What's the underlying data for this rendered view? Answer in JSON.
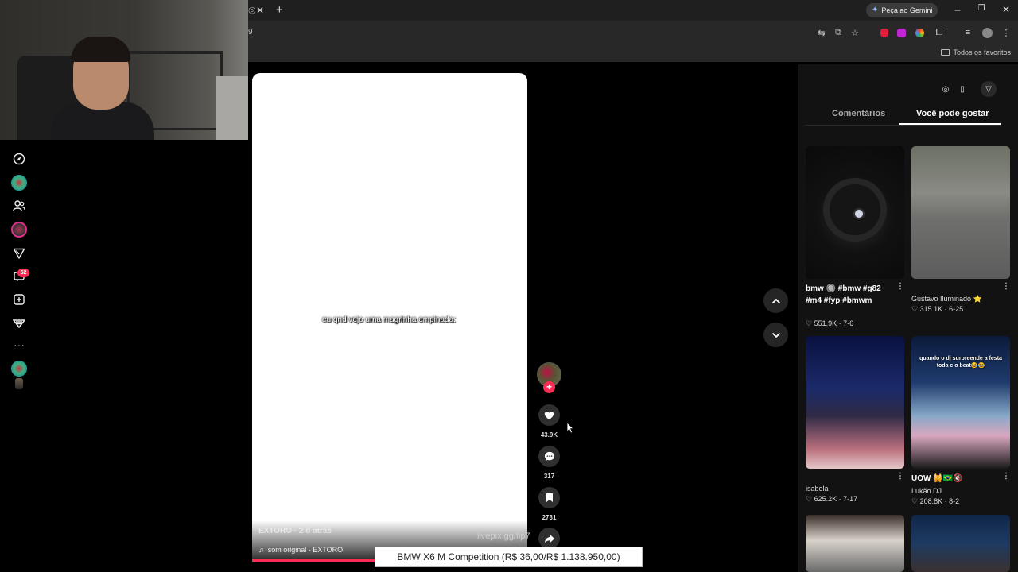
{
  "browser": {
    "gemini_button": "Peça ao Gemini",
    "bookmarks_folder": "Todos os favoritos",
    "url_fragment": "9"
  },
  "sidebar": {
    "notification_count": "62"
  },
  "video": {
    "caption": "eu qnd vejo uma magrinha empinada:",
    "author": "EXTORO · 2 d atrás",
    "sound": "som original - EXTORO",
    "likes": "43.9K",
    "comments": "317",
    "saves": "2731"
  },
  "overlay": {
    "livepix": "livepix.gg/flp7",
    "donation": "BMW X6 M Competition (R$ 36,00/R$ 1.138.950,00)"
  },
  "right_panel": {
    "tabs": [
      "Comentários",
      "Você pode gostar"
    ],
    "cards": [
      {
        "title": "bmw 🔘 #bmw #g82 #m4 #fyp #bmwm",
        "user": "",
        "likes": "551.9K",
        "date": "7-6"
      },
      {
        "title": "",
        "user": "Gustavo Iluminado ⭐",
        "likes": "315.1K",
        "date": "6-25"
      },
      {
        "title": "",
        "user": "isabela",
        "likes": "625.2K",
        "date": "7-17"
      },
      {
        "title": "UOW 🙀🇧🇷🔇",
        "user": "Lukão DJ",
        "likes": "208.8K",
        "date": "8-2"
      }
    ],
    "thumb4_text": "quando o dj surpreende a festa toda c o beat😂😂"
  },
  "icons": [
    "close-icon",
    "plus-icon",
    "minimize-icon",
    "restore-icon",
    "translate-icon",
    "cast-icon",
    "star-icon",
    "extension-icon",
    "profile-icon",
    "more-icon",
    "compass-icon",
    "users-icon",
    "send-icon",
    "inbox-icon",
    "upload-icon",
    "heart-icon",
    "comment-icon",
    "bookmark-icon",
    "share-icon",
    "chevron-up-icon",
    "chevron-down-icon",
    "music-icon"
  ],
  "colors": {
    "accent": "#fe2c55",
    "panel": "#121212",
    "chrome": "#282828"
  }
}
